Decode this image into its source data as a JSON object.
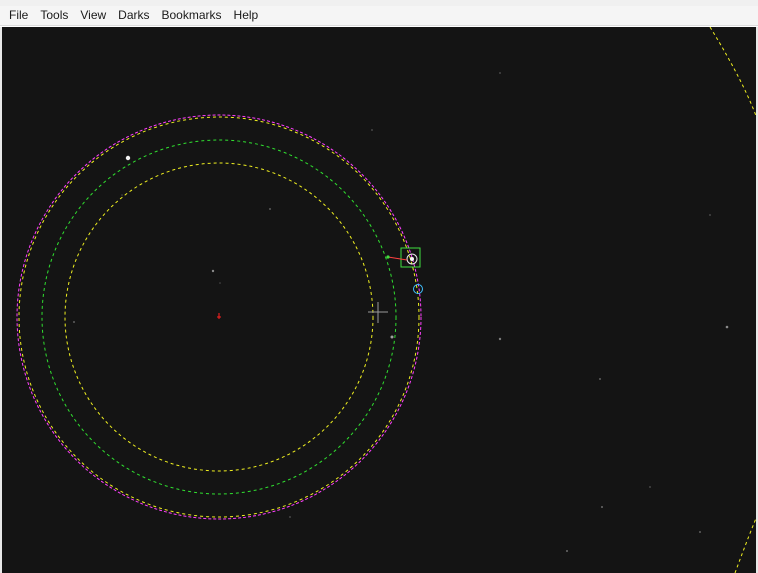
{
  "menu": {
    "items": [
      {
        "label": "File"
      },
      {
        "label": "Tools"
      },
      {
        "label": "View"
      },
      {
        "label": "Darks"
      },
      {
        "label": "Bookmarks"
      },
      {
        "label": "Help"
      }
    ]
  },
  "colors": {
    "background": "#141414",
    "outer_ring": "#ff40ff",
    "guide_ring": "#f0f020",
    "middle_ring": "#30e030",
    "target_box": "#40e040",
    "lock_circle": "#40c0ff",
    "center_mark": "#ff2020",
    "crosshair": "#9a9a9a"
  },
  "icons": {
    "crosshair": "crosshair-icon",
    "center": "center-mark-icon"
  }
}
